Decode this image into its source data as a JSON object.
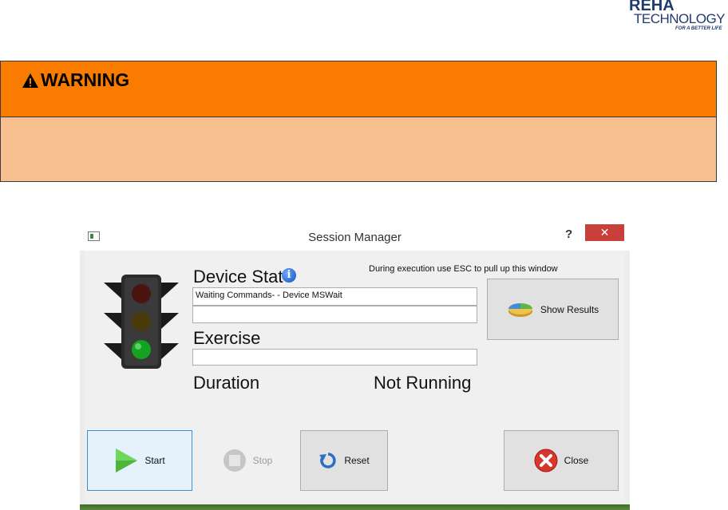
{
  "logo": {
    "line1": "REHA",
    "line2": "TECHNOLOGY",
    "tagline": "FOR A BETTER LIFE"
  },
  "warning": {
    "title": "WARNING",
    "head_color": "#f97b00",
    "body_color": "#f8bf8f"
  },
  "dialog": {
    "title": "Session Manager",
    "help_label": "?",
    "close_label": "✕",
    "hint": "During execution use ESC to pull up this window",
    "device_status_label": "Device Stat",
    "device_status_line1": "Waiting Commands- - Device MSWait",
    "device_status_line2": "",
    "exercise_label": "Exercise",
    "exercise_value": "",
    "duration_label": "Duration",
    "running_state": "Not Running",
    "traffic_light_active": "green",
    "buttons": {
      "show_results": "Show Results",
      "start": "Start",
      "stop": "Stop",
      "reset": "Reset",
      "close": "Close"
    }
  }
}
